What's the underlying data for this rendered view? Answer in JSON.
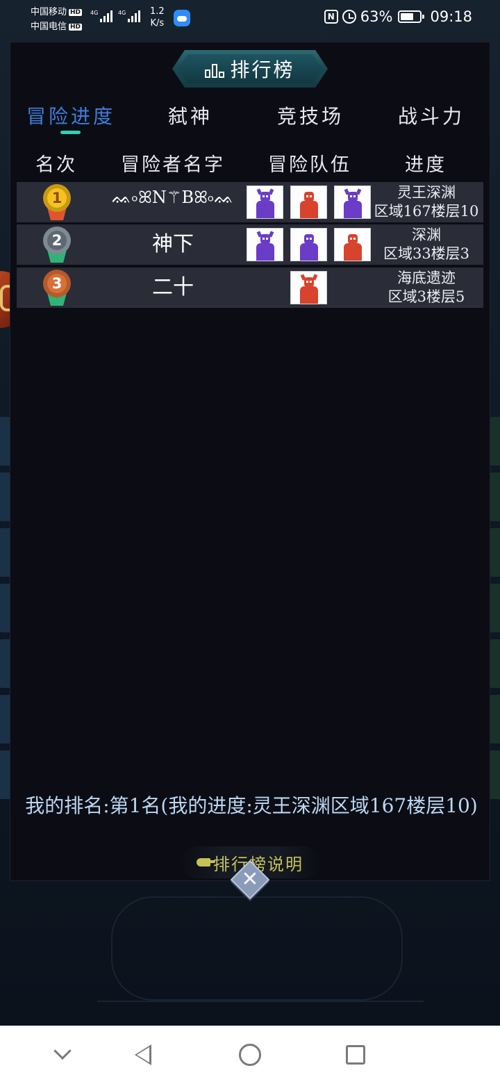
{
  "status_bar": {
    "carrier_1": "中国移动",
    "carrier_2": "中国电信",
    "hd_badge": "HD",
    "network_1": "4G",
    "network_2": "4G",
    "net_speed_value": "1.2",
    "net_speed_unit": "K/s",
    "nfc_label": "N",
    "battery_percent": "63%",
    "time": "09:18"
  },
  "panel": {
    "title": "排行榜"
  },
  "tabs": [
    {
      "label": "冒险进度",
      "active": true
    },
    {
      "label": "弑神",
      "active": false
    },
    {
      "label": "竞技场",
      "active": false
    },
    {
      "label": "战斗力",
      "active": false
    }
  ],
  "columns": {
    "rank": "名次",
    "name": "冒险者名字",
    "team": "冒险队伍",
    "progress": "进度"
  },
  "rows": [
    {
      "rank": "1",
      "name": "ᨐ৹ꕤN⚚Bꕤ৹ᨐ",
      "team": [
        "purple-horned-knight-icon",
        "red-shrine-guardian-icon",
        "purple-armored-demon-icon"
      ],
      "progress_line1": "灵王深渊",
      "progress_line2": "区域167楼层10"
    },
    {
      "rank": "2",
      "name": "神下",
      "team": [
        "purple-bearded-warrior-icon",
        "purple-long-haired-mage-icon",
        "red-flame-warrior-icon"
      ],
      "progress_line1": "深渊",
      "progress_line2": "区域33楼层3"
    },
    {
      "rank": "3",
      "name": "二十",
      "team": [
        "red-bull-demon-icon"
      ],
      "progress_line1": "海底遗迹",
      "progress_line2": "区域3楼层5"
    }
  ],
  "footer": {
    "my_rank": "我的排名:第1名(我的进度:灵王深渊区域167楼层10)",
    "rules_button": "排行榜说明",
    "close_glyph": "✕"
  },
  "colors": {
    "active_tab": "#3f7dde",
    "tab_underline": "#2fd0b0",
    "row_bg": "#2a2c38",
    "my_rank_text": "#b9d6f2",
    "rules_text": "#c6c255"
  }
}
